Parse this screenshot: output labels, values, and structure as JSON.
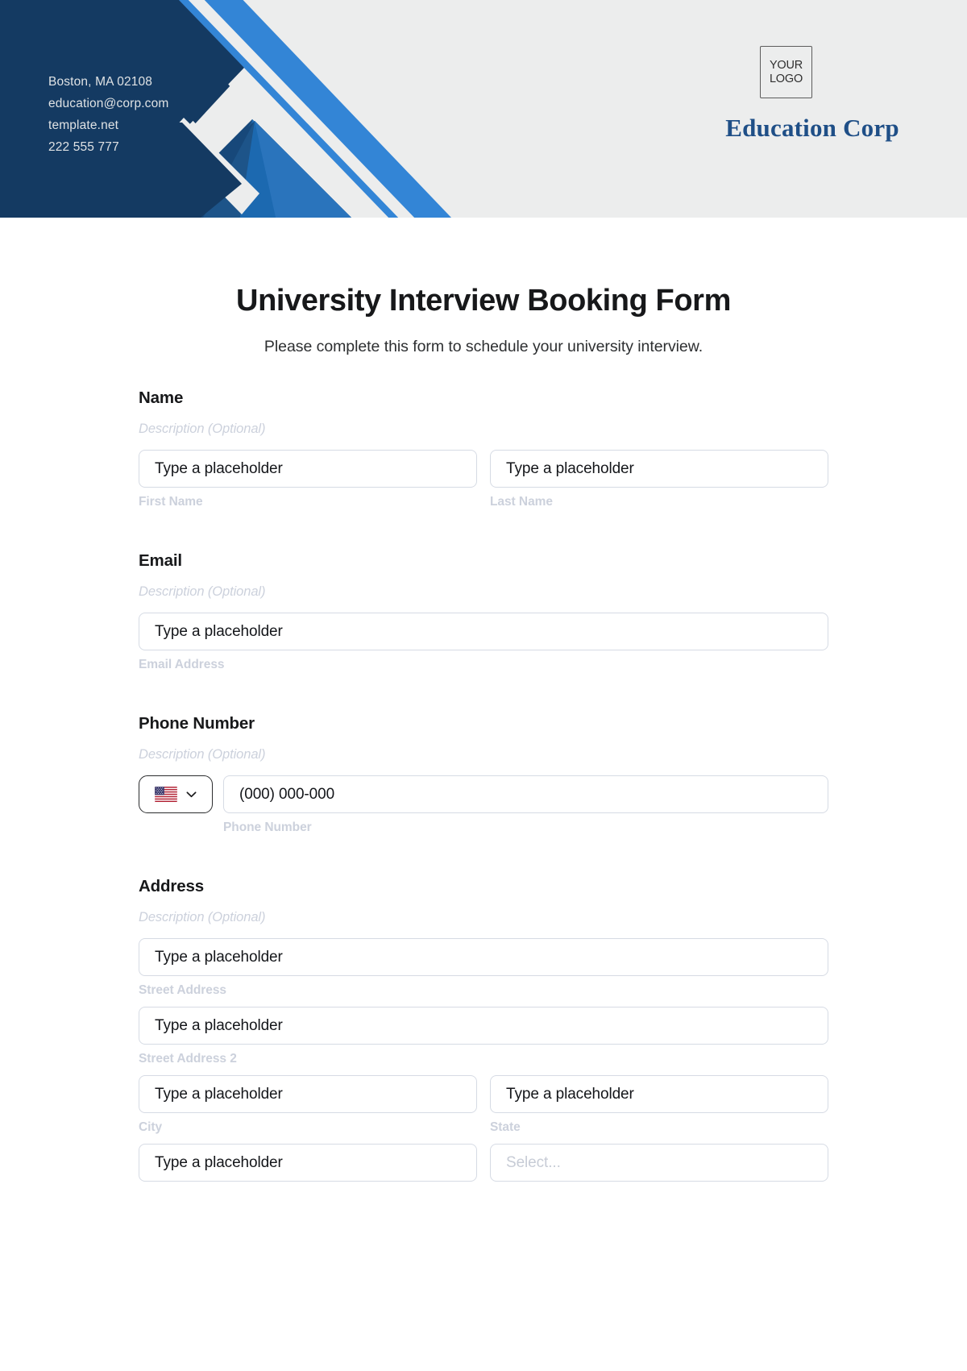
{
  "header": {
    "contact_lines": [
      "Boston, MA 02108",
      "education@corp.com",
      "template.net",
      "222 555 777"
    ],
    "logo_line1": "YOUR",
    "logo_line2": "LOGO",
    "company_name": "Education Corp",
    "colors": {
      "navy": "#143a62",
      "blue_mid": "#1c69b0",
      "blue_bright": "#3385d6",
      "blue_dark": "#17487a",
      "background": "#eceded",
      "brand_text": "#1f4f87"
    }
  },
  "form": {
    "title": "University Interview Booking Form",
    "subtitle": "Please complete this form to schedule your university interview.",
    "description_optional": "Description (Optional)",
    "placeholder": "Type a placeholder",
    "select_placeholder": "Select...",
    "groups": [
      {
        "label": "Name",
        "description": "Description (Optional)",
        "fields": [
          {
            "value": "Type a placeholder",
            "sublabel": "First Name"
          },
          {
            "value": "Type a placeholder",
            "sublabel": "Last Name"
          }
        ]
      },
      {
        "label": "Email",
        "description": "Description (Optional)",
        "fields": [
          {
            "value": "Type a placeholder",
            "sublabel": "Email Address"
          }
        ]
      },
      {
        "label": "Phone Number",
        "description": "Description (Optional)",
        "country_flag": "us-flag-icon",
        "fields": [
          {
            "value": "(000) 000-000",
            "sublabel": "Phone Number"
          }
        ]
      },
      {
        "label": "Address",
        "description": "Description (Optional)",
        "fields": [
          {
            "value": "Type a placeholder",
            "sublabel": "Street Address"
          },
          {
            "value": "Type a placeholder",
            "sublabel": "Street Address 2"
          },
          {
            "value": "Type a placeholder",
            "sublabel": "City"
          },
          {
            "value": "Type a placeholder",
            "sublabel": "State"
          },
          {
            "value": "Type a placeholder",
            "sublabel": ""
          },
          {
            "value": "Select...",
            "sublabel": ""
          }
        ]
      }
    ]
  }
}
